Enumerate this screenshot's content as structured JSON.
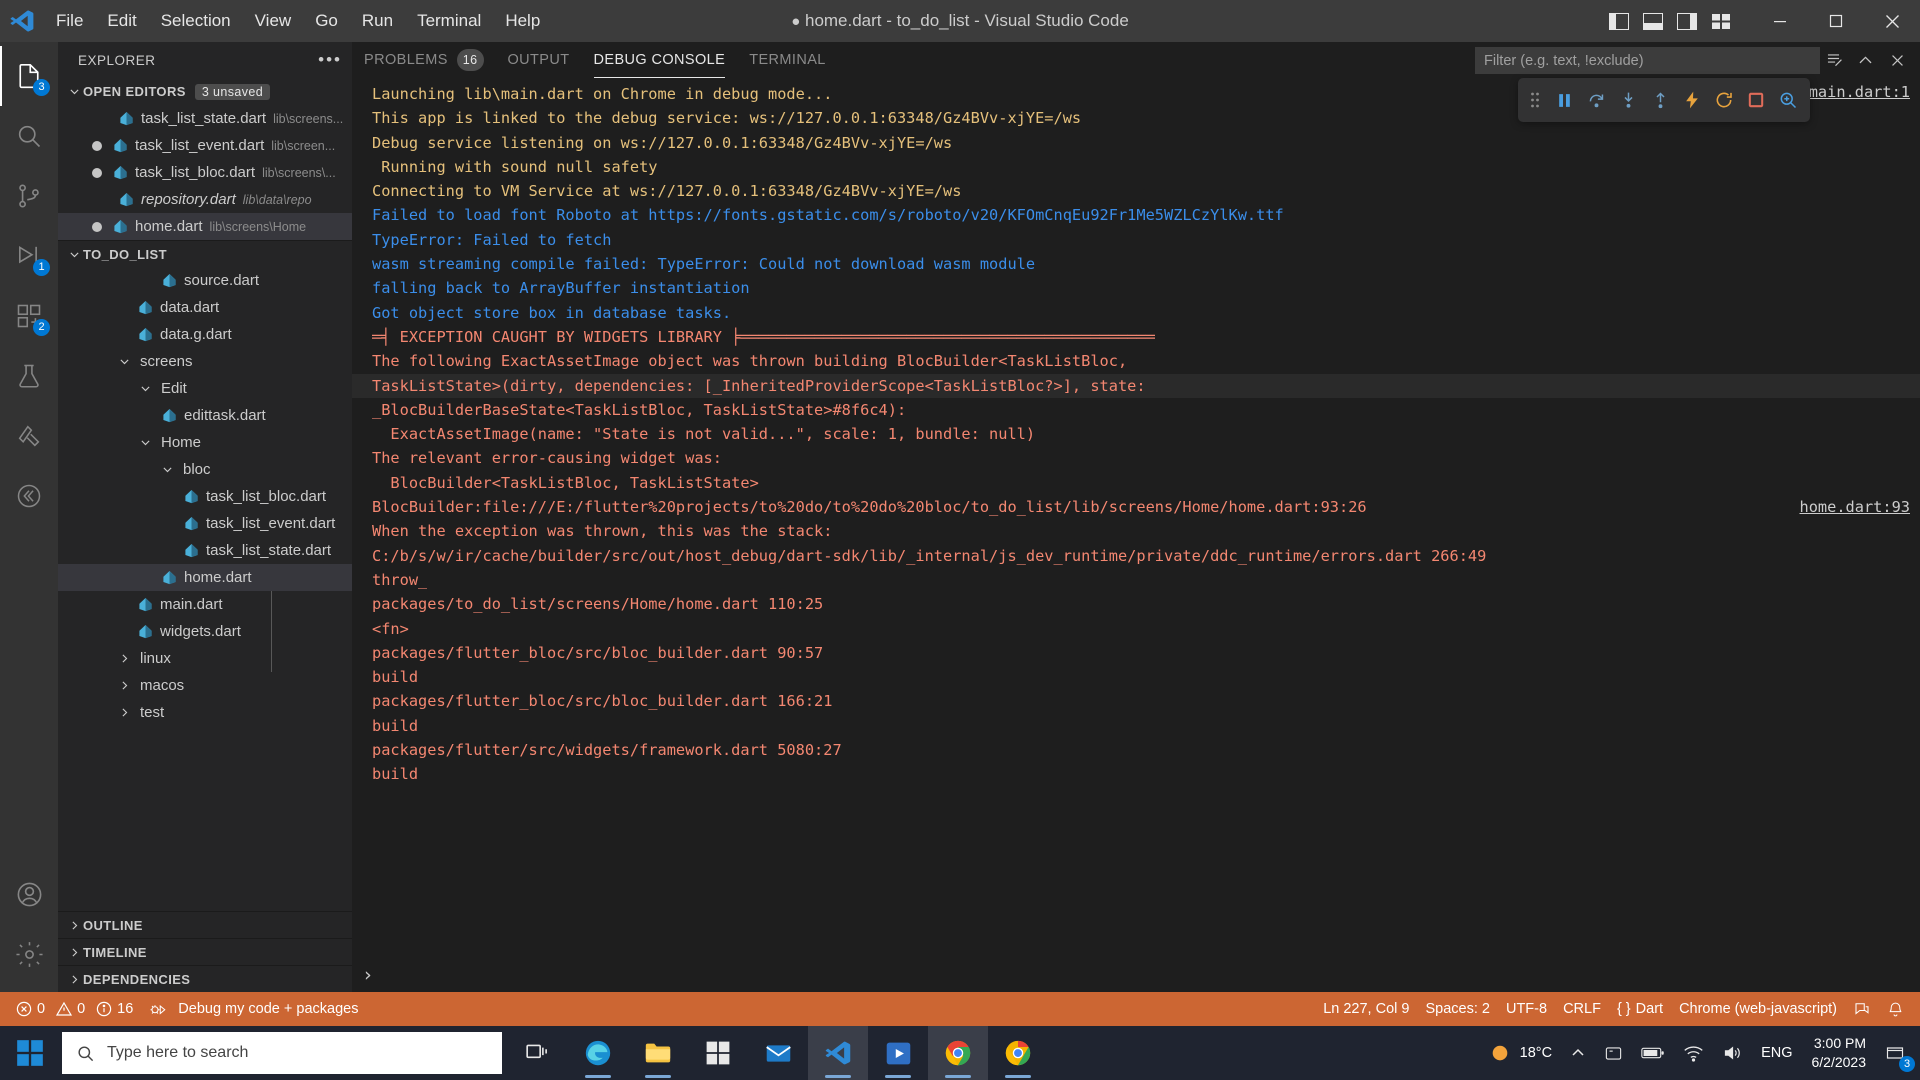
{
  "titlebar": {
    "menu": [
      "File",
      "Edit",
      "Selection",
      "View",
      "Go",
      "Run",
      "Terminal",
      "Help"
    ],
    "title": "home.dart - to_do_list - Visual Studio Code",
    "dirty_dot": "●"
  },
  "activitybar": {
    "items": [
      {
        "name": "explorer",
        "badge": "3"
      },
      {
        "name": "search",
        "badge": ""
      },
      {
        "name": "source-control",
        "badge": ""
      },
      {
        "name": "run-and-debug",
        "badge": "1"
      },
      {
        "name": "extensions",
        "badge": "2"
      },
      {
        "name": "testing",
        "badge": ""
      },
      {
        "name": "dart-devtools",
        "badge": ""
      },
      {
        "name": "flutter",
        "badge": ""
      }
    ],
    "bottom": [
      {
        "name": "accounts"
      },
      {
        "name": "settings"
      }
    ]
  },
  "sidebar": {
    "header": "EXPLORER",
    "more_label": "•••",
    "open_editors": {
      "label": "OPEN EDITORS",
      "badge": "3 unsaved",
      "items": [
        {
          "name": "task_list_state.dart",
          "path": "lib\\screens...",
          "dirty": false,
          "italic": false,
          "selected": false
        },
        {
          "name": "task_list_event.dart",
          "path": "lib\\screen...",
          "dirty": true,
          "italic": false,
          "selected": false
        },
        {
          "name": "task_list_bloc.dart",
          "path": "lib\\screens\\...",
          "dirty": true,
          "italic": false,
          "selected": false
        },
        {
          "name": "repository.dart",
          "path": "lib\\data\\repo",
          "dirty": false,
          "italic": true,
          "selected": false
        },
        {
          "name": "home.dart",
          "path": "lib\\screens\\Home",
          "dirty": true,
          "italic": false,
          "selected": true
        }
      ]
    },
    "project": {
      "label": "TO_DO_LIST",
      "tree": [
        {
          "type": "file",
          "label": "source.dart",
          "indent": 2,
          "selected": false
        },
        {
          "type": "file",
          "label": "data.dart",
          "indent": 1,
          "selected": false
        },
        {
          "type": "file",
          "label": "data.g.dart",
          "indent": 1,
          "selected": false
        },
        {
          "type": "folder",
          "label": "screens",
          "indent": 1,
          "open": true
        },
        {
          "type": "folder",
          "label": "Edit",
          "indent": 2,
          "open": true
        },
        {
          "type": "file",
          "label": "edittask.dart",
          "indent": 3,
          "selected": false
        },
        {
          "type": "folder",
          "label": "Home",
          "indent": 2,
          "open": true
        },
        {
          "type": "folder",
          "label": "bloc",
          "indent": 3,
          "open": true
        },
        {
          "type": "file",
          "label": "task_list_bloc.dart",
          "indent": 4,
          "selected": false
        },
        {
          "type": "file",
          "label": "task_list_event.dart",
          "indent": 4,
          "selected": false
        },
        {
          "type": "file",
          "label": "task_list_state.dart",
          "indent": 4,
          "selected": false
        },
        {
          "type": "file",
          "label": "home.dart",
          "indent": 3,
          "selected": true
        },
        {
          "type": "file",
          "label": "main.dart",
          "indent": 1,
          "selected": false
        },
        {
          "type": "file",
          "label": "widgets.dart",
          "indent": 1,
          "selected": false
        },
        {
          "type": "folder",
          "label": "linux",
          "indent": 1,
          "open": false
        },
        {
          "type": "folder",
          "label": "macos",
          "indent": 1,
          "open": false
        },
        {
          "type": "folder",
          "label": "test",
          "indent": 1,
          "open": false
        }
      ]
    },
    "collapsed_sections": [
      "OUTLINE",
      "TIMELINE",
      "DEPENDENCIES"
    ]
  },
  "panel": {
    "tabs": [
      {
        "label": "PROBLEMS",
        "count": "16",
        "active": false
      },
      {
        "label": "OUTPUT",
        "count": "",
        "active": false
      },
      {
        "label": "DEBUG CONSOLE",
        "count": "",
        "active": true
      },
      {
        "label": "TERMINAL",
        "count": "",
        "active": false
      }
    ],
    "filter_placeholder": "Filter (e.g. text, !exclude)",
    "filter_value": "",
    "actions": [
      "clear-console-icon",
      "chevron-up-icon",
      "close-icon"
    ],
    "debug_toolbar": [
      "grip-icon",
      "pause-icon",
      "step-over-icon",
      "step-into-icon",
      "step-out-icon",
      "hot-reload-icon",
      "restart-icon",
      "stop-icon",
      "inspect-widget-icon"
    ],
    "prompt": "›"
  },
  "console": {
    "top_link": "main.dart:1",
    "lines": [
      {
        "t": "Launching lib\\main.dart on Chrome in debug mode...",
        "c": "y"
      },
      {
        "t": "This app is linked to the debug service: ws://127.0.0.1:63348/Gz4BVv-xjYE=/ws",
        "c": "y"
      },
      {
        "t": "Debug service listening on ws://127.0.0.1:63348/Gz4BVv-xjYE=/ws",
        "c": "y"
      },
      {
        "t": " Running with sound null safety",
        "c": "y"
      },
      {
        "t": "Connecting to VM Service at ws://127.0.0.1:63348/Gz4BVv-xjYE=/ws",
        "c": "y"
      },
      {
        "t": "Failed to load font Roboto at https://fonts.gstatic.com/s/roboto/v20/KFOmCnqEu92Fr1Me5WZLCzYlKw.ttf",
        "c": "b"
      },
      {
        "t": "TypeError: Failed to fetch",
        "c": "b"
      },
      {
        "t": "wasm streaming compile failed: TypeError: Could not download wasm module",
        "c": "b"
      },
      {
        "t": "falling back to ArrayBuffer instantiation",
        "c": "b"
      },
      {
        "t": "Got object store box in database tasks.",
        "c": "b"
      },
      {
        "t": "═╡ EXCEPTION CAUGHT BY WIDGETS LIBRARY ╞═════════════════════════════════════════════",
        "c": "r"
      },
      {
        "t": "The following ExactAssetImage object was thrown building BlocBuilder<TaskListBloc,",
        "c": "r"
      },
      {
        "t": "TaskListState>(dirty, dependencies: [_InheritedProviderScope<TaskListBloc?>], state:",
        "c": "r",
        "hl": true
      },
      {
        "t": "_BlocBuilderBaseState<TaskListBloc, TaskListState>#8f6c4):",
        "c": "r"
      },
      {
        "t": "  ExactAssetImage(name: \"State is not valid...\", scale: 1, bundle: null)",
        "c": "r"
      },
      {
        "t": "The relevant error-causing widget was:",
        "c": "r"
      },
      {
        "t": "  BlocBuilder<TaskListBloc, TaskListState>",
        "c": "r"
      },
      {
        "t": "BlocBuilder:file:///E:/flutter%20projects/to%20do/to%20do%20bloc/to_do_list/lib/screens/Home/home.dart:93:26",
        "c": "r",
        "link": "home.dart:93"
      },
      {
        "t": "When the exception was thrown, this was the stack:",
        "c": "r"
      },
      {
        "t": "C:/b/s/w/ir/cache/builder/src/out/host_debug/dart-sdk/lib/_internal/js_dev_runtime/private/ddc_runtime/errors.dart 266:49",
        "c": "r"
      },
      {
        "t": "throw_",
        "c": "r"
      },
      {
        "t": "packages/to_do_list/screens/Home/home.dart 110:25",
        "c": "r"
      },
      {
        "t": "<fn>",
        "c": "r"
      },
      {
        "t": "packages/flutter_bloc/src/bloc_builder.dart 90:57",
        "c": "r"
      },
      {
        "t": "build",
        "c": "r"
      },
      {
        "t": "packages/flutter_bloc/src/bloc_builder.dart 166:21",
        "c": "r"
      },
      {
        "t": "build",
        "c": "r"
      },
      {
        "t": "packages/flutter/src/widgets/framework.dart 5080:27",
        "c": "r"
      },
      {
        "t": "build",
        "c": "r"
      }
    ]
  },
  "statusbar": {
    "errors": "0",
    "warnings": "0",
    "infos": "16",
    "debug_label": "Debug my code + packages",
    "position": "Ln 227, Col 9",
    "spaces": "Spaces: 2",
    "encoding": "UTF-8",
    "eol": "CRLF",
    "language": "Dart",
    "target": "Chrome (web-javascript)",
    "accent": "#cc6633"
  },
  "taskbar": {
    "search_placeholder": "Type here to search",
    "apps": [
      "task-view-icon",
      "edge-icon",
      "file-explorer-icon",
      "microsoft-store-icon",
      "mail-icon",
      "vscode-icon",
      "media-player-icon",
      "chrome-icon",
      "chrome-icon-2"
    ],
    "weather_temp": "18°C",
    "language": "ENG",
    "time": "3:00 PM",
    "date": "6/2/2023",
    "notification_count": "3"
  }
}
